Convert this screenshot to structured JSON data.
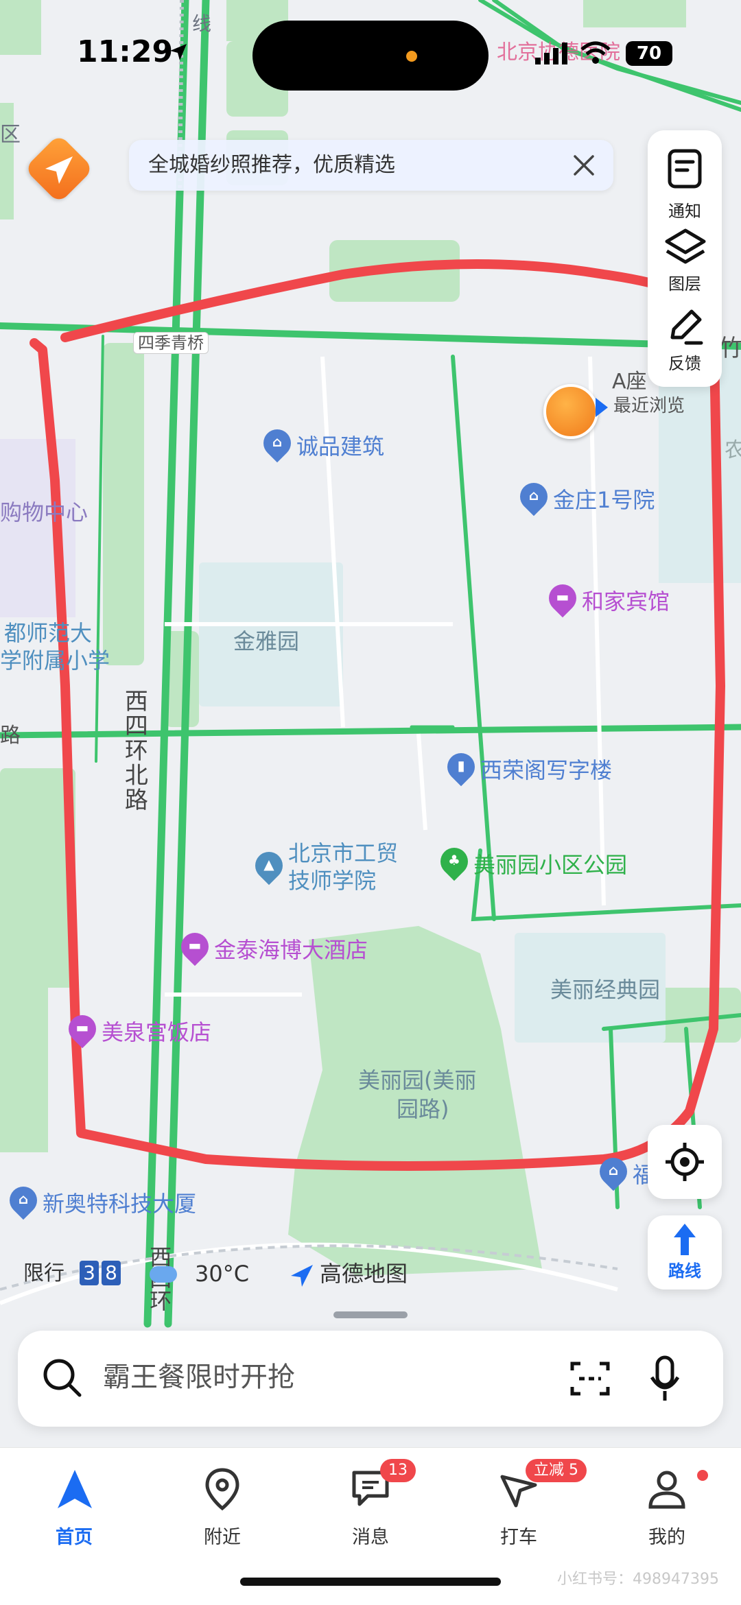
{
  "status_bar": {
    "time": "11:29",
    "battery": "70",
    "carrier_label_bg": "北京协德医院"
  },
  "banner": {
    "text": "全城婚纱照推荐，优质精选"
  },
  "side_panel": {
    "notice": "通知",
    "layers": "图层",
    "feedback": "反馈"
  },
  "map_labels": {
    "line_top": "线",
    "district": "区",
    "zhu": "竹",
    "nong": "农",
    "bridge": "四季青桥",
    "mall": "购物中心",
    "school_near": "首都师范大学附属小学",
    "school_near_l1": "都师范大",
    "school_near_l2": "学附属小学",
    "lu": "路",
    "road_vertical": "西四环北路",
    "road_bottom": "西四环",
    "jinya": "金雅园",
    "meili_classic": "美丽经典园",
    "meili_park_area_l1": "美丽园(美丽",
    "meili_park_area_l2": "园路)",
    "a_zuo": "A座",
    "recent": "最近浏览"
  },
  "pois": {
    "chengpin": "诚品建筑",
    "jinzhuang": "金庄1号院",
    "hejia": "和家宾馆",
    "xirong": "西荣阁写字楼",
    "gongmao_l1": "北京市工贸",
    "gongmao_l2": "技师学院",
    "meiliyuan_park": "美丽园小区公园",
    "jintaihai": "金泰海博大酒店",
    "meiquan": "美泉宫饭店",
    "xinaote": "新奥特科技大厦",
    "fu": "福"
  },
  "map_footer": {
    "restriction_label": "限行",
    "restriction_nums": [
      "3",
      "8"
    ],
    "temperature": "30°C",
    "brand": "高德地图"
  },
  "buttons": {
    "route": "路线"
  },
  "search": {
    "placeholder": "霸王餐限时开抢"
  },
  "tabs": [
    {
      "label": "首页",
      "active": true
    },
    {
      "label": "附近"
    },
    {
      "label": "消息",
      "badge": "13"
    },
    {
      "label": "打车",
      "badge": "立减 5"
    },
    {
      "label": "我的"
    }
  ],
  "watermark": "小红书号：498947395",
  "colors": {
    "road_green": "#3ec46d",
    "accent_blue": "#1b6cf2",
    "annotation_red": "#f0474b",
    "poi_blue": "#4f7fd1",
    "poi_purple": "#b64fd1",
    "poi_green": "#2fb14a"
  }
}
